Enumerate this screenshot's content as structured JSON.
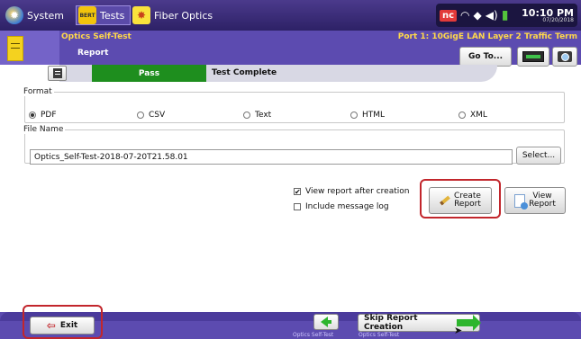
{
  "topbar": {
    "system_label": "System",
    "tests_label": "Tests",
    "tests_badge": "BERT",
    "fiber_label": "Fiber Optics",
    "status": {
      "nc_badge": "nc",
      "time": "10:10 PM",
      "date": "07/20/2018"
    }
  },
  "header": {
    "title": "Optics Self-Test",
    "subtitle": "Report",
    "port_info": "Port 1: 10GigE LAN Layer 2 Traffic Term",
    "goto_label": "Go To..."
  },
  "status_strip": {
    "result": "Pass",
    "state": "Test Complete",
    "colors": {
      "pass": "#1e8e1e"
    }
  },
  "format": {
    "legend": "Format",
    "options": [
      {
        "label": "PDF",
        "selected": true
      },
      {
        "label": "CSV",
        "selected": false
      },
      {
        "label": "Text",
        "selected": false
      },
      {
        "label": "HTML",
        "selected": false
      },
      {
        "label": "XML",
        "selected": false
      }
    ]
  },
  "file": {
    "legend": "File Name",
    "value": "Optics_Self-Test-2018-07-20T21.58.01",
    "select_label": "Select..."
  },
  "options": {
    "view_after": {
      "label": "View report after creation",
      "checked": true
    },
    "include_log": {
      "label": "Include message log",
      "checked": false
    }
  },
  "actions": {
    "create_label_1": "Create",
    "create_label_2": "Report",
    "view_label_1": "View",
    "view_label_2": "Report"
  },
  "bottom": {
    "exit_label": "Exit",
    "back_caption": "Optics Self-Test",
    "skip_label": "Skip Report Creation",
    "skip_caption": "Optics Self-Test"
  },
  "colors": {
    "header": "#5c4bb0",
    "highlight": "#c2262c",
    "topbar": "#2d2166"
  }
}
